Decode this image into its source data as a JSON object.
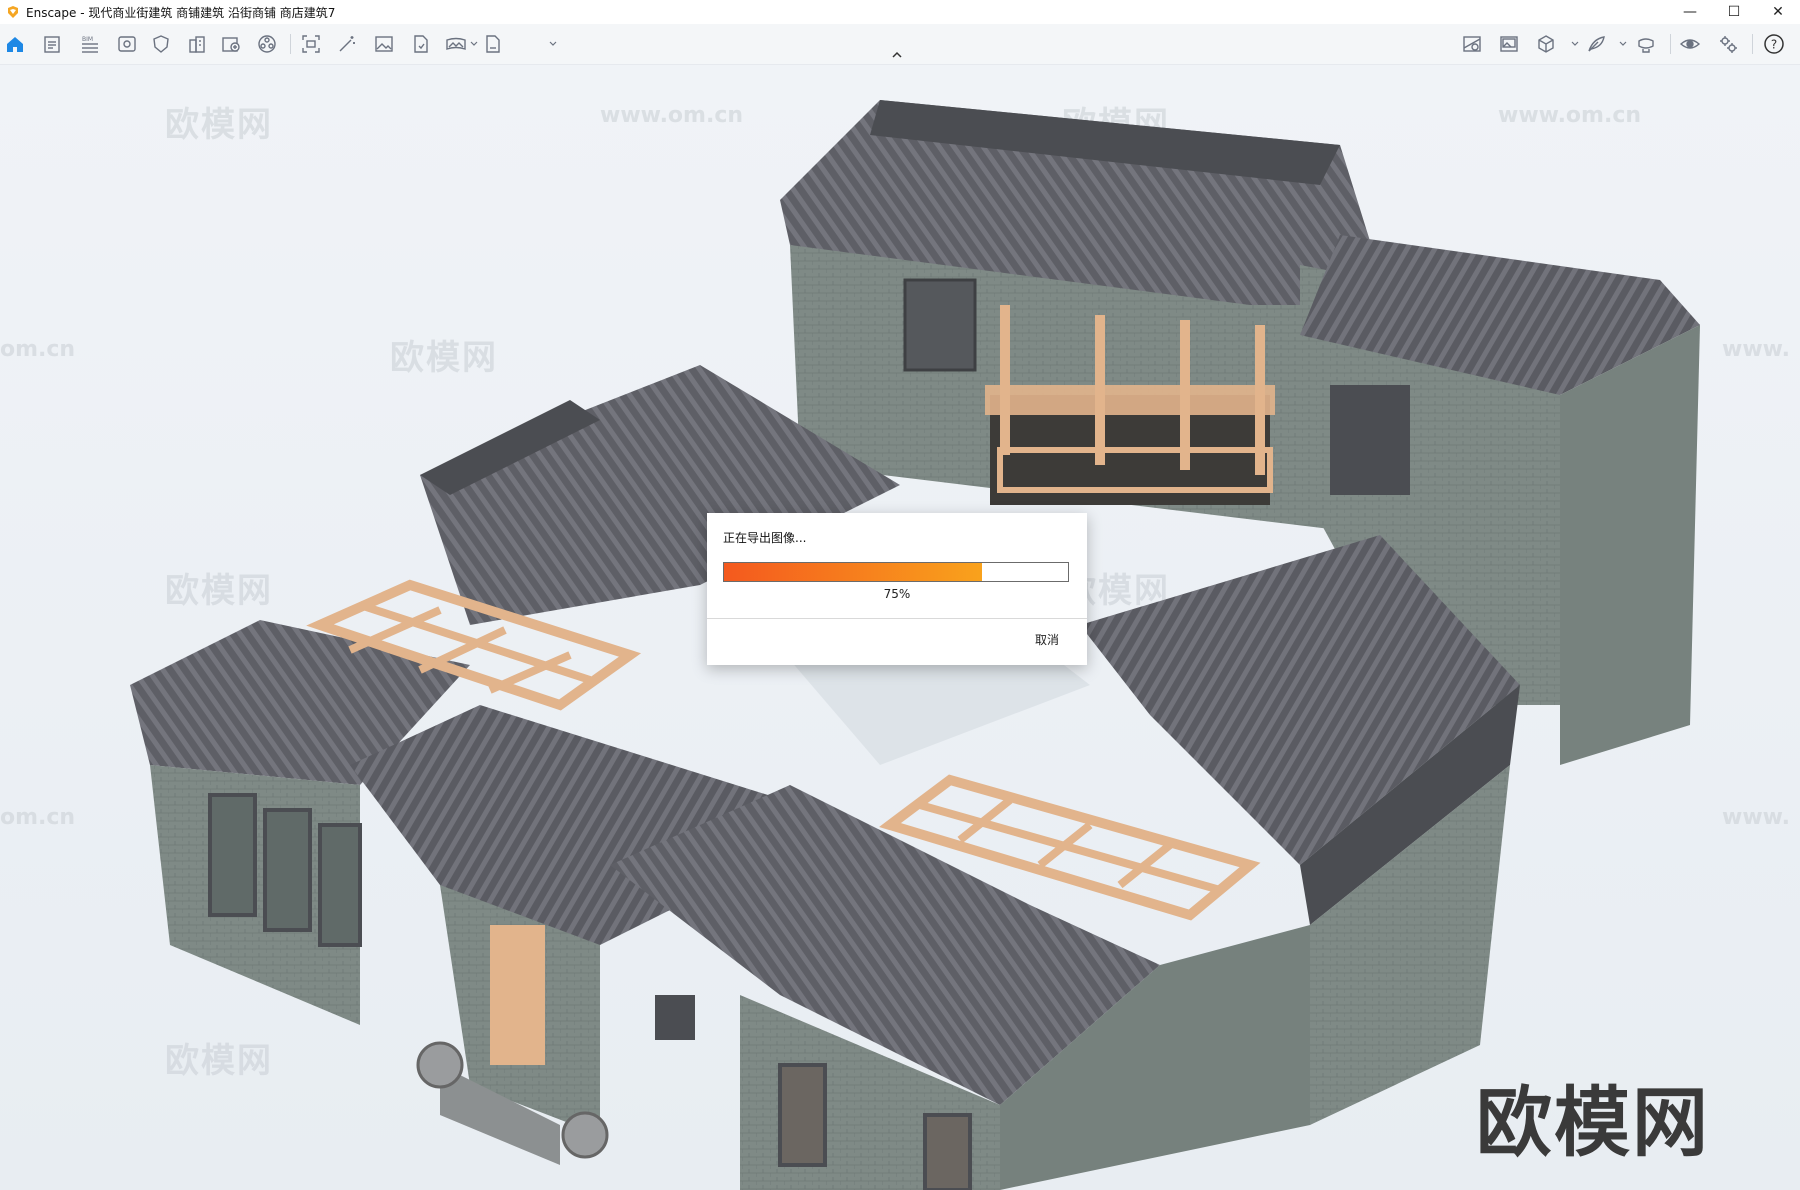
{
  "window": {
    "title": "Enscape - 现代商业街建筑 商铺建筑 沿街商铺 商店建筑7",
    "minimize": "—",
    "maximize": "☐",
    "close": "✕"
  },
  "toolbar": {
    "left_icons": [
      "home-icon",
      "document-icon",
      "bim-list-icon",
      "view-icon",
      "shield-icon",
      "building-icon",
      "asset-library-icon",
      "material-icon",
      "screenshot-icon",
      "magic-wand-icon",
      "image-icon",
      "export-file-icon",
      "panorama-icon",
      "batch-render-icon"
    ],
    "right_icons": [
      "map-icon",
      "gallery-icon",
      "cube-icon",
      "feather-icon",
      "vr-headset-icon",
      "eye-icon",
      "settings-icon",
      "help-icon"
    ],
    "bim_badge": "BIM",
    "help_label": "?"
  },
  "viewport": {
    "watermark_cn": "欧模网",
    "watermark_url": "www.om.cn",
    "watermark_partial_left": "om.cn",
    "watermark_partial_right": "www.",
    "brand_mark": "欧模网",
    "colors": {
      "roof": "#5e5f66",
      "wall": "#7f8a86",
      "wood": "#e2b48c",
      "frame": "#4b4d52"
    }
  },
  "dialog": {
    "title": "正在导出图像...",
    "progress_value": 0.75,
    "progress_text": "75%",
    "cancel_label": "取消"
  }
}
